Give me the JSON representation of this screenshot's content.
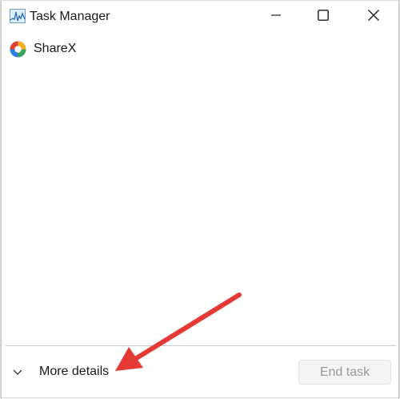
{
  "window": {
    "title": "Task Manager",
    "app_icon": "task-manager-icon"
  },
  "titlebar_buttons": {
    "minimize_icon": "minimize-icon",
    "maximize_icon": "maximize-icon",
    "close_icon": "close-icon"
  },
  "processes": [
    {
      "name": "ShareX",
      "icon": "sharex-icon"
    }
  ],
  "footer": {
    "more_details_label": "More details",
    "end_task_label": "End task",
    "end_task_enabled": false
  },
  "annotation": {
    "arrow_color": "#e53935",
    "points_to": "more-details"
  }
}
